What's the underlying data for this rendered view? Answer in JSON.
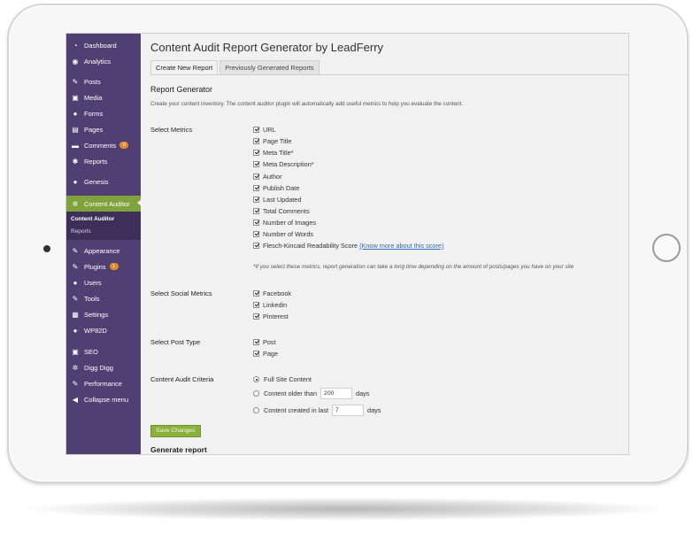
{
  "sidebar": {
    "items": [
      {
        "label": "Dashboard",
        "icon": "dashboard-icon",
        "glyph": "◔"
      },
      {
        "label": "Analytics",
        "icon": "analytics-icon",
        "glyph": "◉"
      },
      {
        "label": "Posts",
        "icon": "pin-icon",
        "glyph": "✎"
      },
      {
        "label": "Media",
        "icon": "media-icon",
        "glyph": "▣"
      },
      {
        "label": "Forms",
        "icon": "forms-icon",
        "glyph": "●"
      },
      {
        "label": "Pages",
        "icon": "pages-icon",
        "glyph": "▤"
      },
      {
        "label": "Comments",
        "icon": "comments-icon",
        "glyph": "▬",
        "badge": "0"
      },
      {
        "label": "Reports",
        "icon": "reports-icon",
        "glyph": "✱"
      },
      {
        "label": "Genesis",
        "icon": "genesis-icon",
        "glyph": "●"
      },
      {
        "label": "Content Auditor",
        "icon": "gear-icon",
        "glyph": "✲",
        "active": true
      },
      {
        "label": "Appearance",
        "icon": "appearance-icon",
        "glyph": "✎"
      },
      {
        "label": "Plugins",
        "icon": "plugins-icon",
        "glyph": "✎",
        "badge": "1"
      },
      {
        "label": "Users",
        "icon": "users-icon",
        "glyph": "●"
      },
      {
        "label": "Tools",
        "icon": "tools-icon",
        "glyph": "✎"
      },
      {
        "label": "Settings",
        "icon": "settings-icon",
        "glyph": "▦"
      },
      {
        "label": "WP82D",
        "icon": "wp82d-icon",
        "glyph": "●"
      },
      {
        "label": "SEO",
        "icon": "seo-icon",
        "glyph": "▣"
      },
      {
        "label": "Digg Digg",
        "icon": "digg-icon",
        "glyph": "✲"
      },
      {
        "label": "Performance",
        "icon": "performance-icon",
        "glyph": "✎"
      },
      {
        "label": "Collapse menu",
        "icon": "collapse-icon",
        "glyph": "◀"
      }
    ],
    "submenu": {
      "current": "Content Auditor",
      "other": "Reports"
    }
  },
  "page": {
    "title": "Content Audit Report Generator by LeadFerry",
    "tabs": [
      "Create New Report",
      "Previously Generated Reports"
    ],
    "section_title": "Report Generator",
    "description": "Create your content inventory. The content auditor plugin will automatically add useful metrics to help you evaluate the content."
  },
  "metrics": {
    "label": "Select Metrics",
    "items": [
      "URL",
      "Page Title",
      "Meta Title*",
      "Meta Description*",
      "Author",
      "Publish Date",
      "Last Updated",
      "Total Comments",
      "Number of Images",
      "Number of Words",
      "Flesch-Kincaid Readability Score"
    ],
    "link": "(Know more about this score)",
    "note": "*If you select these metrics, report generation can take a long time depending on the amount of posts/pages you have on your site"
  },
  "social": {
    "label": "Select Social Metrics",
    "items": [
      "Facebook",
      "Linkedin",
      "Pinterest"
    ]
  },
  "post_type": {
    "label": "Select Post Type",
    "items": [
      "Post",
      "Page"
    ]
  },
  "criteria": {
    "label": "Content Audit Criteria",
    "full_site": "Full Site Content",
    "older_label": "Content older than",
    "older_value": "200",
    "created_label": "Content created in last",
    "created_value": "7",
    "days": "days"
  },
  "save_label": "Save Changes",
  "generate_title": "Generate report"
}
